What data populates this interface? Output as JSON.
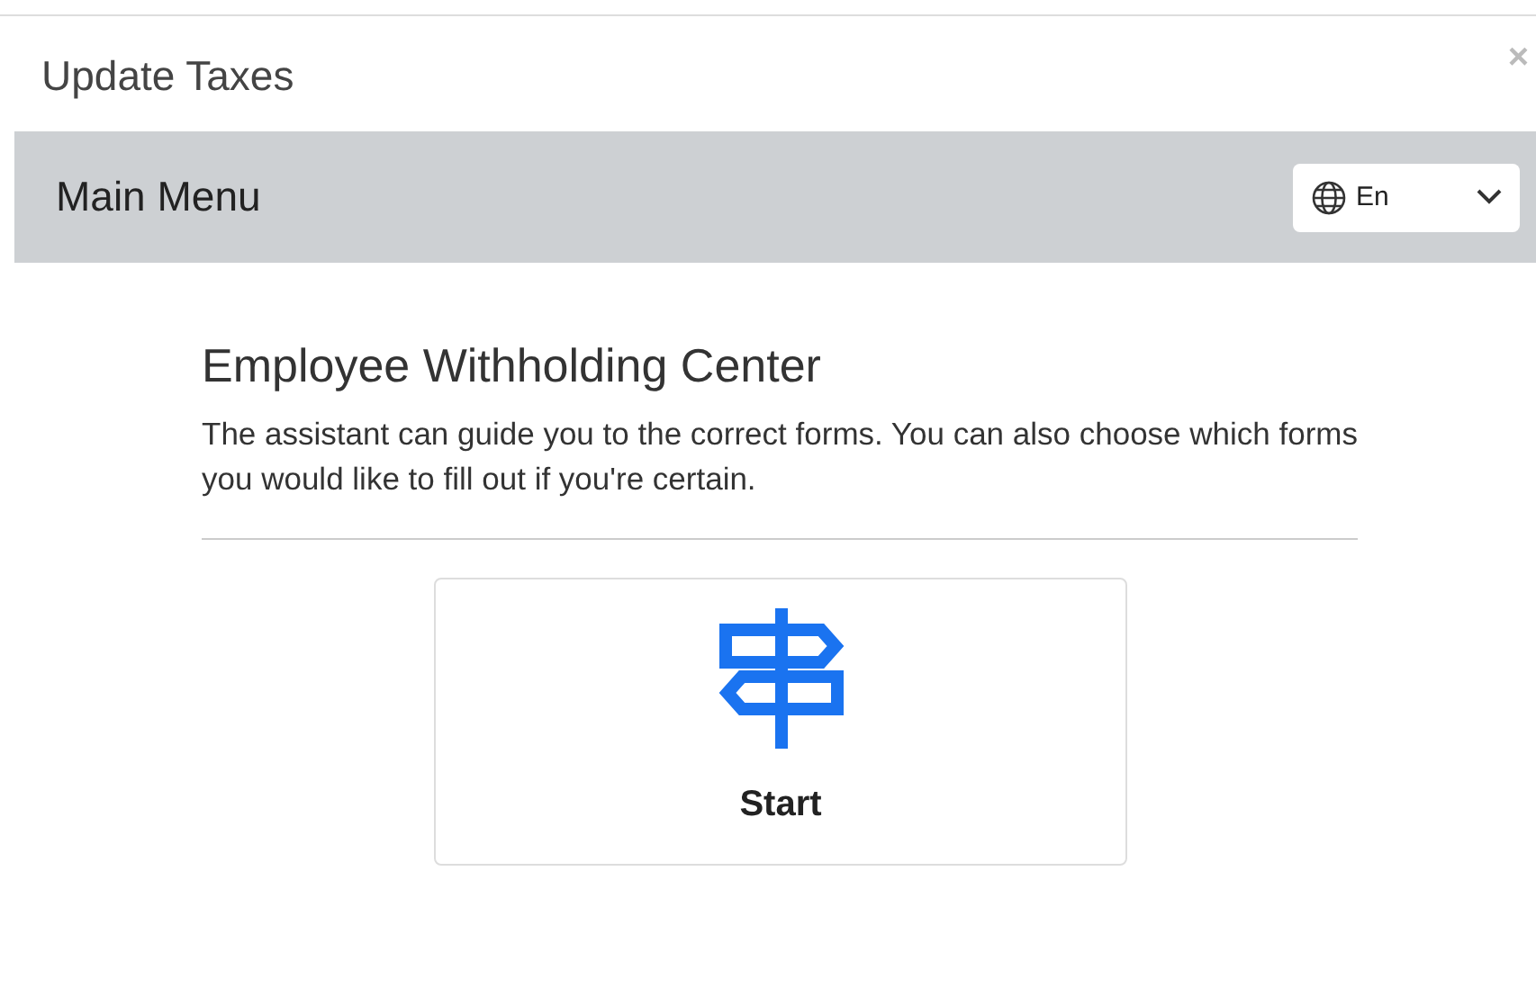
{
  "window": {
    "title": "Update Taxes",
    "close": "×"
  },
  "menu_bar": {
    "title": "Main Menu",
    "language": {
      "value": "En"
    }
  },
  "section": {
    "heading": "Employee Withholding Center",
    "description": "The assistant can guide you to the correct forms. You can also choose which forms you would like to fill out if you're certain."
  },
  "start_card": {
    "label": "Start"
  }
}
